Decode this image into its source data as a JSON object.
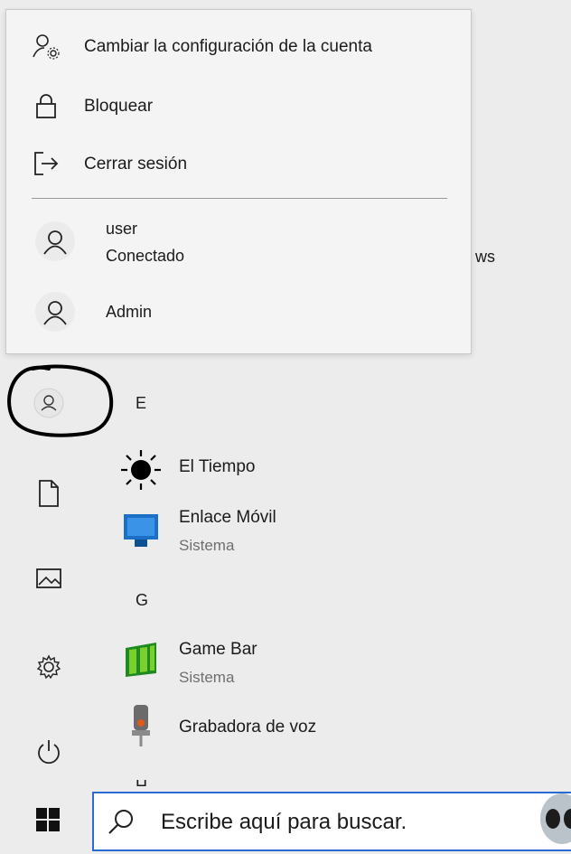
{
  "account_menu": {
    "items": [
      {
        "icon": "account-settings-icon",
        "label": "Cambiar la configuración de la cuenta"
      },
      {
        "icon": "lock-icon",
        "label": "Bloquear"
      },
      {
        "icon": "sign-out-icon",
        "label": "Cerrar sesión"
      }
    ],
    "users": [
      {
        "icon": "user-avatar-icon",
        "name": "user",
        "status": "Conectado"
      },
      {
        "icon": "user-avatar-icon",
        "name": "Admin"
      }
    ]
  },
  "peek_text": "ws",
  "rail": {
    "items": [
      "user-icon",
      "documents-icon",
      "pictures-icon",
      "settings-icon",
      "power-icon"
    ]
  },
  "app_list": {
    "sections": [
      {
        "letter": "E",
        "apps": [
          {
            "icon": "weather-sun-icon",
            "name": "El Tiempo"
          },
          {
            "icon": "phone-link-icon",
            "name": "Enlace Móvil",
            "subtitle": "Sistema"
          }
        ]
      },
      {
        "letter": "G",
        "apps": [
          {
            "icon": "game-bar-icon",
            "name": "Game Bar",
            "subtitle": "Sistema"
          },
          {
            "icon": "voice-recorder-icon",
            "name": "Grabadora de voz"
          }
        ]
      },
      {
        "letter": "H",
        "apps": []
      }
    ]
  },
  "taskbar": {
    "start_icon": "windows-logo-icon",
    "search_placeholder": "Escribe aquí para buscar.",
    "cortana_icon": "alien-avatar-icon"
  },
  "colors": {
    "background": "#ececec",
    "popup": "#f4f4f4",
    "search_border": "#2a6bd1",
    "annotation": "#000000"
  }
}
